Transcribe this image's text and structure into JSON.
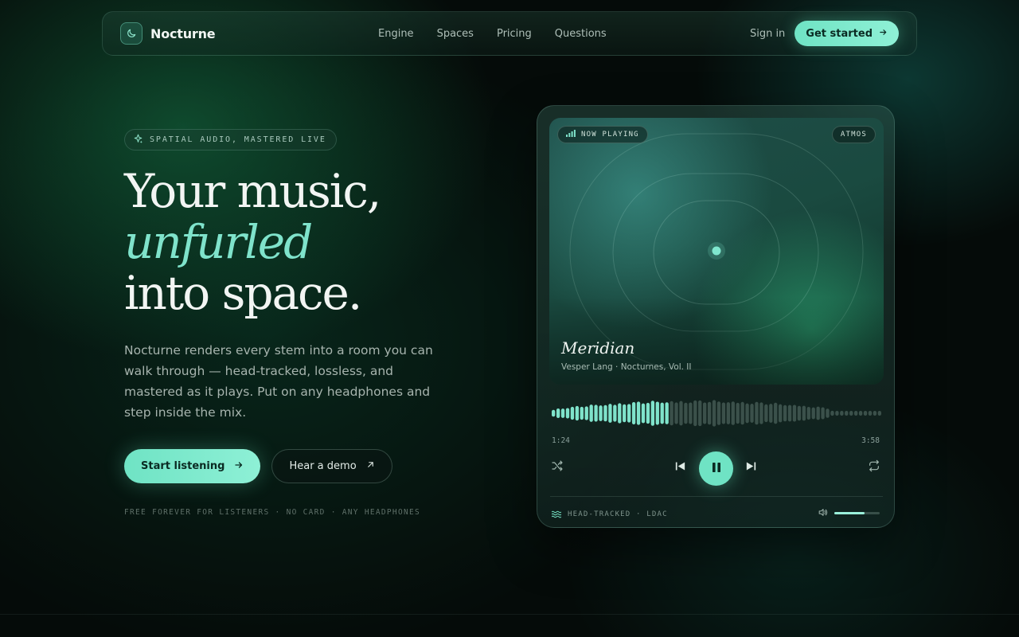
{
  "nav": {
    "brand": "Nocturne",
    "links": [
      "Engine",
      "Spaces",
      "Pricing",
      "Questions"
    ],
    "sign_in": "Sign in",
    "get_started": "Get started"
  },
  "hero": {
    "badge": "SPATIAL AUDIO, MASTERED LIVE",
    "headline_line1": "Your music,",
    "headline_accent": "unfurled",
    "headline_line3": "into space.",
    "lede": "Nocturne renders every stem into a room you can walk through — head-tracked, lossless, and mastered as it plays. Put on any headphones and step inside the mix.",
    "cta_primary": "Start listening",
    "cta_secondary": "Hear a demo",
    "footnote": "FREE FOREVER FOR LISTENERS · NO CARD · ANY HEADPHONES"
  },
  "player": {
    "now_playing": "NOW PLAYING",
    "format_badge": "ATMOS",
    "track_title": "Meridian",
    "track_subtitle": "Vesper Lang · Nocturnes, Vol. II",
    "time_current": "1:24",
    "time_total": "3:58",
    "playback_progress": 0.35,
    "volume_level": 0.67,
    "footer_status": "HEAD-TRACKED · LDAC"
  },
  "colors": {
    "accent": "#6fe3c4",
    "accent_text": "#7fe3cb",
    "background": "#050b09"
  },
  "icons": {
    "brand": "moon-icon",
    "badge": "sparkle-icon",
    "cta_primary": "arrow-right-icon",
    "cta_secondary": "arrow-up-right-icon",
    "signal": "signal-bars-icon",
    "shuffle": "shuffle-icon",
    "previous": "skip-previous-icon",
    "pause": "pause-icon",
    "next": "skip-next-icon",
    "repeat": "repeat-icon",
    "spatial": "waves-icon",
    "volume": "volume-icon"
  }
}
